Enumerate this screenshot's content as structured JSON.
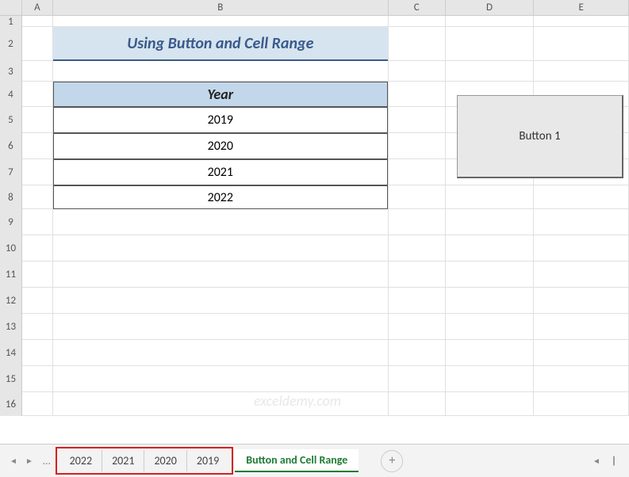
{
  "columns": [
    "A",
    "B",
    "C",
    "D",
    "E"
  ],
  "rows": [
    "1",
    "2",
    "3",
    "4",
    "5",
    "6",
    "7",
    "8",
    "9",
    "10",
    "11",
    "12",
    "13",
    "14",
    "15",
    "16"
  ],
  "title": "Using Button and Cell Range",
  "table": {
    "header": "Year",
    "data": [
      "2019",
      "2020",
      "2021",
      "2022"
    ]
  },
  "button": {
    "label": "Button 1"
  },
  "watermark": "exceldemy.com",
  "tabs": {
    "highlighted": [
      "2022",
      "2021",
      "2020",
      "2019"
    ],
    "active": "Button and Cell Range"
  },
  "nav": {
    "prev": "◄",
    "next": "►",
    "dots": "…",
    "add": "+"
  },
  "chart_data": {
    "type": "table",
    "title": "Using Button and Cell Range",
    "columns": [
      "Year"
    ],
    "rows": [
      [
        "2019"
      ],
      [
        "2020"
      ],
      [
        "2021"
      ],
      [
        "2022"
      ]
    ]
  }
}
